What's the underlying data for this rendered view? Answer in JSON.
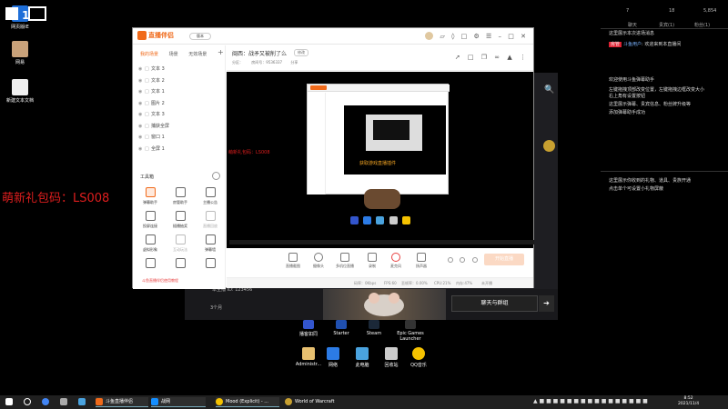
{
  "desktop": {
    "icons": [
      {
        "label": "网页版IE",
        "name": "ie"
      },
      {
        "label": "网易",
        "name": "user-folder"
      },
      {
        "label": "新建文本文档",
        "name": "text-doc"
      }
    ],
    "promo_text": "萌新礼包码：LS008",
    "bottom_icons": [
      {
        "label": "播客如同",
        "name": "app1"
      },
      {
        "label": "Starter",
        "name": "starter"
      },
      {
        "label": "Steam",
        "name": "steam"
      },
      {
        "label": "Epic Games Launcher",
        "name": "epic"
      },
      {
        "label": "Administr...",
        "name": "admin"
      },
      {
        "label": "网络",
        "name": "network"
      },
      {
        "label": "此电脑",
        "name": "this-pc"
      },
      {
        "label": "回收站",
        "name": "recycle-bin"
      },
      {
        "label": "QQ音乐",
        "name": "qq-music"
      }
    ]
  },
  "bg_window": {
    "bottom_small_text": "本主播 ID: 123456",
    "count_text": "3个月",
    "chat_button": "聊天与群组"
  },
  "sidebar": {
    "stats": [
      "7",
      "18",
      "5,854"
    ],
    "tabs": [
      "聊天",
      "贵宾(1)",
      "粉丝(1)"
    ],
    "messages": [
      "这里展示本次进场消息",
      "欢迎来到本直播间",
      "欢迎使用斗鱼弹幕助手",
      "左键拖拽顶部改变位置，左键拖拽边框改变大小",
      "右上角有设置按钮",
      "这里展示弹幕、贵宾信息、粉丝牌升级等",
      "添加弹幕助手成功",
      "这里展示你收到的礼物、道具、贵族开通",
      "点击单个可设置小礼物屏蔽"
    ],
    "admin_badge": "房管",
    "admin_user": "斗鱼用户"
  },
  "main_window": {
    "app_name": "直播伴侣",
    "version_tag": "版本",
    "scene_tabs": [
      "我的场景",
      "场景",
      "无效场景"
    ],
    "scenes": [
      "文本 3",
      "文本 2",
      "文本 1",
      "图片 2",
      "文本 3",
      "捕获全屏",
      "窗口 1",
      "全屏 1"
    ],
    "tools_title": "工具箱",
    "tools": [
      {
        "label": "弹幕助手",
        "active": true
      },
      {
        "label": "房管助手",
        "active": false
      },
      {
        "label": "主播公告",
        "active": false
      },
      {
        "label": "投屏连接",
        "active": false
      },
      {
        "label": "插播抽奖",
        "active": false
      },
      {
        "label": "直播回放",
        "active": false
      },
      {
        "label": "虚拟形象",
        "active": false
      },
      {
        "label": "互动玩法",
        "active": false
      },
      {
        "label": "弹幕墙",
        "active": false
      },
      {
        "label": "工具",
        "active": false
      },
      {
        "label": "游戏助手",
        "active": false
      },
      {
        "label": "下载",
        "active": false
      }
    ],
    "tool_footer": "斗鱼直播伴侣使用教程",
    "stream_title": "闽西：战矛又被削了么",
    "modify_label": "修改",
    "stream_meta": [
      "分区：",
      "房间号：9536337",
      "分享"
    ],
    "controls": [
      "直播截图",
      "摄像头",
      "多机位直播",
      "录制",
      "麦克风",
      "扬声器"
    ],
    "start_button": "开始直播",
    "status": [
      "码率：0Kbps",
      "FPS:60",
      "丢帧率：0.00%",
      "CPU:21%",
      "内存:47%",
      "未开播"
    ],
    "preview_promo": "萌新礼包码：LS008",
    "preview_orange": "获取游戏直播插件"
  },
  "taskbar": {
    "items": [
      "斗鱼直播伴侣",
      "战网",
      "Mood (Explicit) - ...",
      "World of Warcraft"
    ],
    "time": "8:52",
    "date": "2021/11/4"
  },
  "colors": {
    "accent": "#f06a1a",
    "promo_red": "#e01e1e",
    "taskbar": "#202020"
  }
}
